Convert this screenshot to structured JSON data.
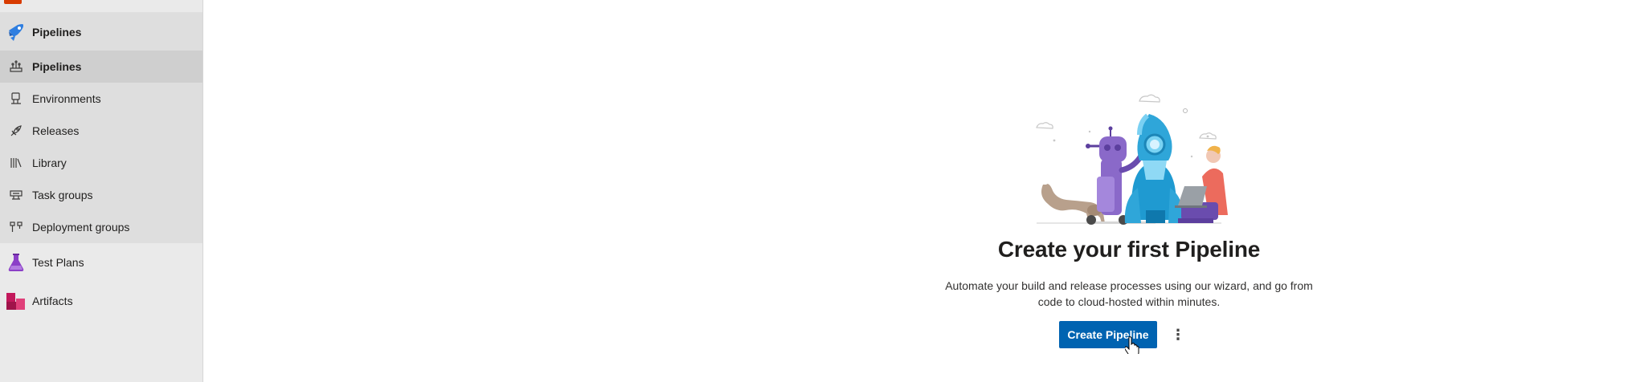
{
  "sidebar": {
    "hub": {
      "label": "Pipelines",
      "icon": "pipelines-hub-icon"
    },
    "items": [
      {
        "label": "Pipelines",
        "icon": "pipelines-icon",
        "selected": true
      },
      {
        "label": "Environments",
        "icon": "environments-icon"
      },
      {
        "label": "Releases",
        "icon": "rocket-icon"
      },
      {
        "label": "Library",
        "icon": "library-icon"
      },
      {
        "label": "Task groups",
        "icon": "task-groups-icon"
      },
      {
        "label": "Deployment groups",
        "icon": "deployment-groups-icon"
      }
    ],
    "test_plans": {
      "label": "Test Plans",
      "icon": "test-plans-flask-icon"
    },
    "artifacts": {
      "label": "Artifacts",
      "icon": "artifacts-icon"
    }
  },
  "main": {
    "illustration": "pipeline-robot-rocket-illustration",
    "title": "Create your first Pipeline",
    "description": "Automate your build and release processes using our wizard, and go from code to cloud-hosted within minutes.",
    "primary_button": "Create Pipeline",
    "more_icon": "more-options-icon"
  },
  "colors": {
    "sidebar_bg": "#eaeaea",
    "selected_bg": "#cfcfcf",
    "primary": "#0063b1",
    "pipelines_brand": "#2f7ee0",
    "test_plans_brand": "#8b3fc7",
    "artifacts_brand": "#c2185b"
  }
}
